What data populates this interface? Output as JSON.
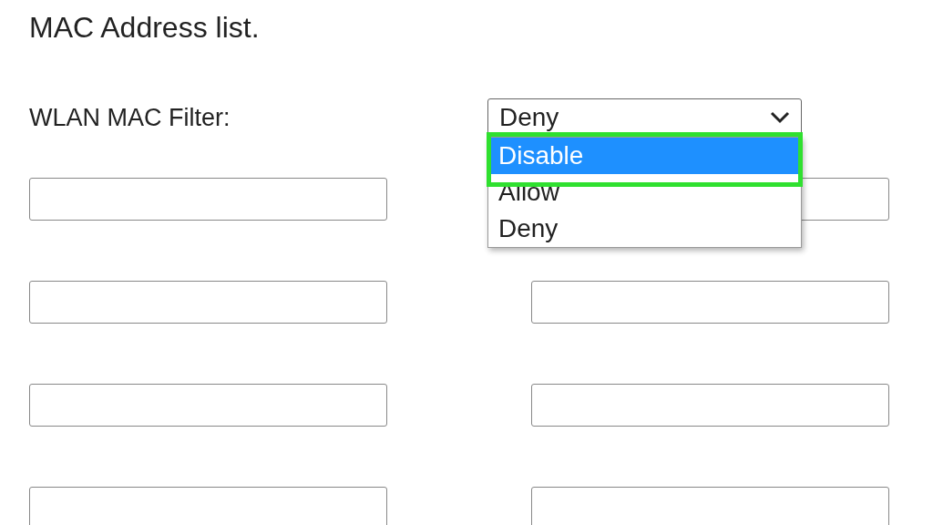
{
  "heading": "MAC Address list.",
  "filter": {
    "label": "WLAN MAC Filter:",
    "value": "Deny",
    "expanded": true,
    "options": [
      {
        "label": "Disable",
        "highlighted": true
      },
      {
        "label": "Allow",
        "highlighted": false
      },
      {
        "label": "Deny",
        "highlighted": false
      }
    ]
  }
}
